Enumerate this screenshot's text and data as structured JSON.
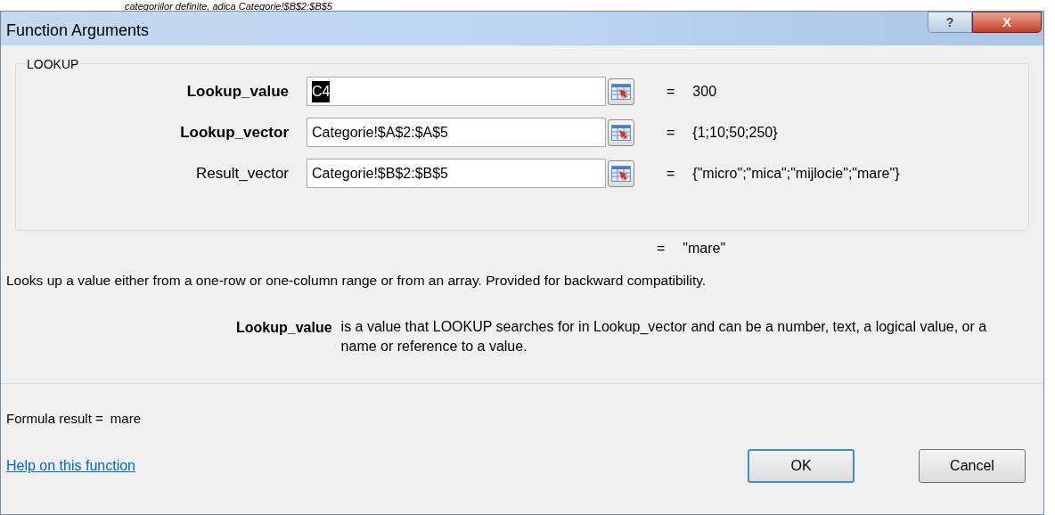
{
  "background_text": "categoriilor definite, adica Categorie!$B$2:$B$5",
  "window": {
    "title": "Function Arguments",
    "buttons": [
      "?",
      "X"
    ]
  },
  "group": {
    "title": "LOOKUP",
    "arguments": [
      {
        "label": "Lookup_value",
        "required": true,
        "value": "C4",
        "text_selected": true,
        "result": "300"
      },
      {
        "label": "Lookup_vector",
        "required": true,
        "value": "Categorie!$A$2:$A$5",
        "text_selected": false,
        "result": "{1;10;50;250}"
      },
      {
        "label": "Result_vector",
        "required": false,
        "value": "Categorie!$B$2:$B$5",
        "text_selected": false,
        "result": "{\"micro\";\"mica\";\"mijlocie\";\"mare\"}"
      }
    ]
  },
  "function_result": "\"mare\"",
  "equals": "=",
  "description": "Looks up a value either from a one-row or one-column range or from an array. Provided for backward compatibility.",
  "argument_help": {
    "name": "Lookup_value",
    "text": "is a value that LOOKUP searches for in Lookup_vector and can be a number, text, a logical value, or a name or reference to a value."
  },
  "formula_result": {
    "label": "Formula result =",
    "value": "mare"
  },
  "help_link": "Help on this function",
  "buttons": [
    {
      "label": "OK",
      "default": true
    },
    {
      "label": "Cancel",
      "default": false
    }
  ]
}
